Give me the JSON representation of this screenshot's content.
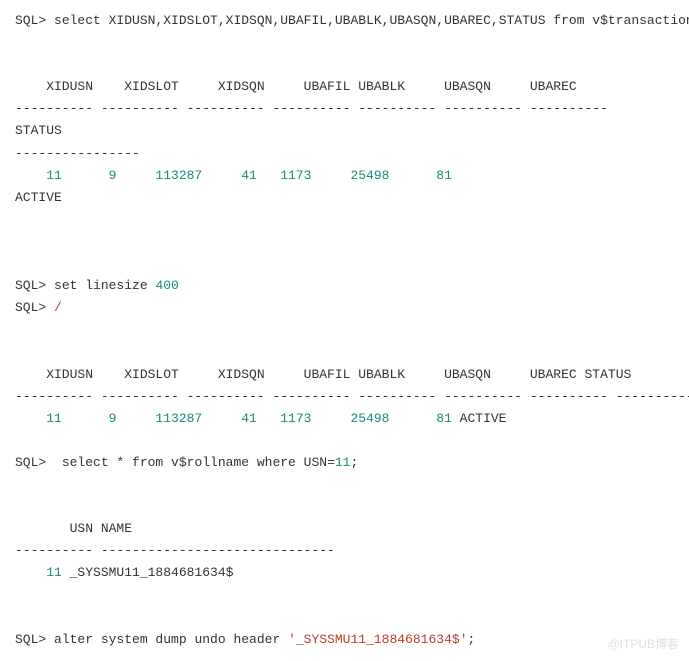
{
  "q1": {
    "prompt": "SQL>",
    "cmd_pre": " select XIDUSN,XIDSLOT,XIDSQN,UBAFIL,UBABLK,UBASQN,UBAREC,STATUS from v$transaction;",
    "headers1": "    XIDUSN    XIDSLOT     XIDSQN     UBAFIL UBABLK     UBASQN     UBAREC",
    "sep1": "---------- ---------- ---------- ---------- ---------- ---------- ----------",
    "headers2": "STATUS",
    "sep2": "----------------",
    "row_nums": "    11      9     113287     41   1173     25498      81",
    "row_status": "ACTIVE"
  },
  "q2": {
    "prompt1": "SQL>",
    "cmd1_pre": " set linesize ",
    "cmd1_num": "400",
    "prompt2": "SQL>",
    "slash": " /",
    "headers": "    XIDUSN    XIDSLOT     XIDSQN     UBAFIL UBABLK     UBASQN     UBAREC STATUS",
    "sep": "---------- ---------- ---------- ---------- ---------- ---------- ---------- ----------------",
    "row_nums": "    11      9     113287     41   1173     25498      81",
    "row_status": " ACTIVE"
  },
  "q3": {
    "prompt": "SQL>",
    "cmd_pre": "  select * from v$rollname where USN=",
    "cmd_num": "11",
    "cmd_post": ";",
    "headers": "       USN NAME",
    "sep": "---------- ------------------------------",
    "row_num": "    11",
    "row_name": " _SYSSMU11_1884681634$"
  },
  "q4": {
    "prompt": "SQL>",
    "cmd_pre": " alter system dump undo header ",
    "cmd_str": "'_SYSSMU11_1884681634$'",
    "cmd_post": ";"
  },
  "watermark": "@ITPUB博客"
}
